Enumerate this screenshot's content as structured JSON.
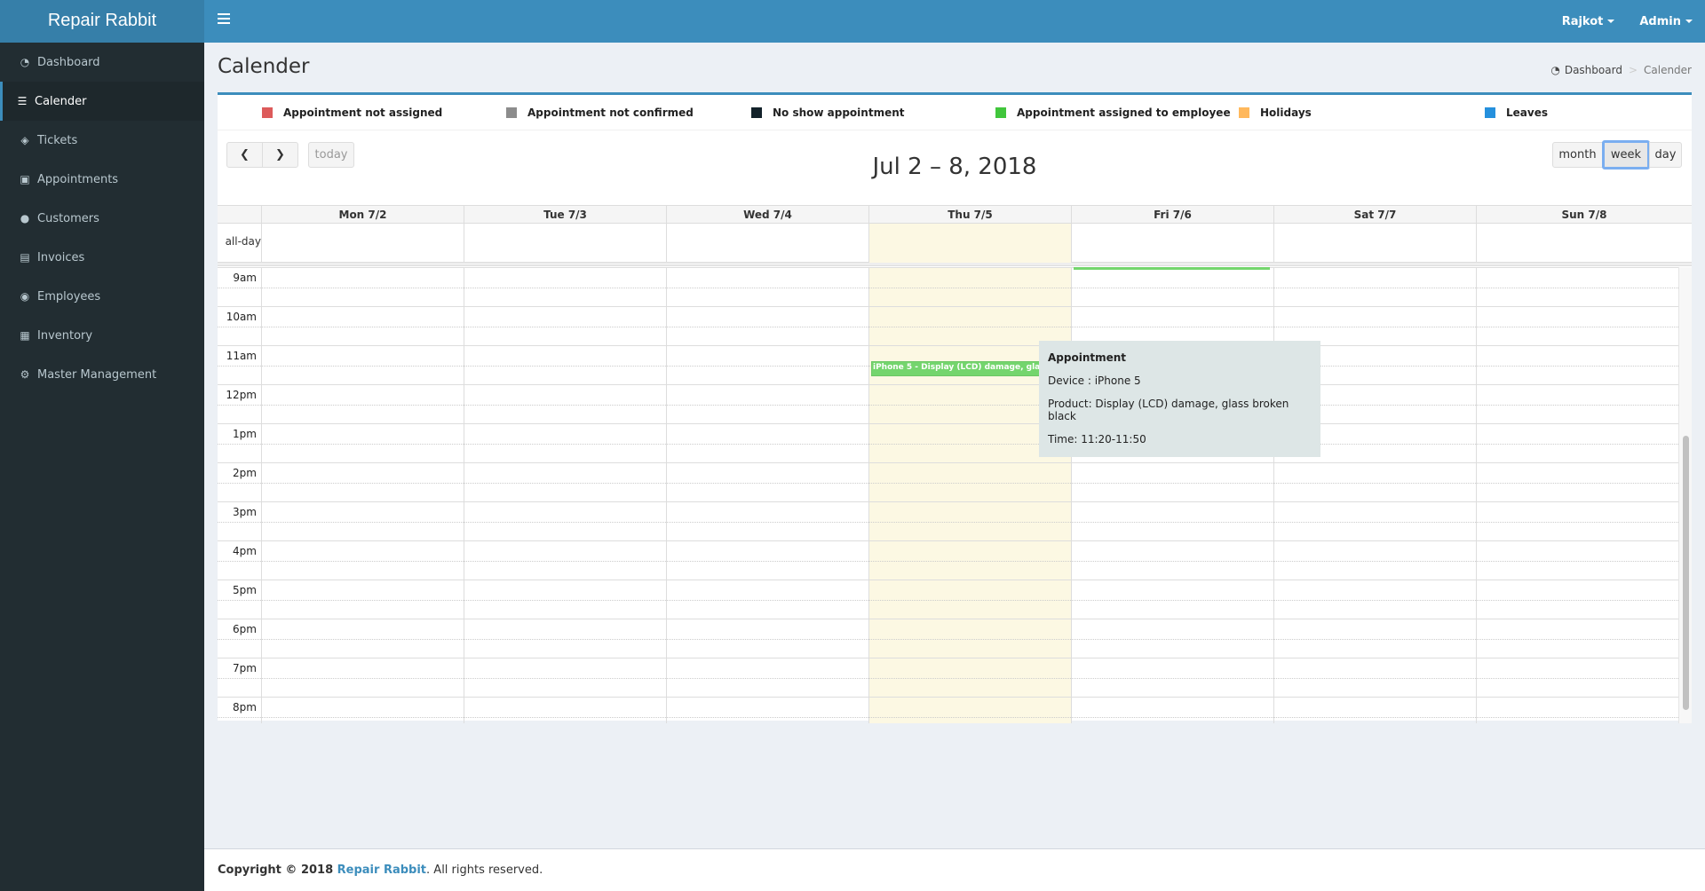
{
  "app": {
    "name": "Repair Rabbit"
  },
  "topnav": {
    "location": "Rajkot",
    "user": "Admin"
  },
  "sidebar": {
    "items": [
      {
        "label": "Dashboard",
        "icon": "dashboard-icon",
        "active": false
      },
      {
        "label": "Calender",
        "icon": "list-ol-icon",
        "active": true
      },
      {
        "label": "Tickets",
        "icon": "ticket-icon",
        "active": false
      },
      {
        "label": "Appointments",
        "icon": "calendar-plus-icon",
        "active": false
      },
      {
        "label": "Customers",
        "icon": "users-icon",
        "active": false
      },
      {
        "label": "Invoices",
        "icon": "file-text-icon",
        "active": false
      },
      {
        "label": "Employees",
        "icon": "user-circle-icon",
        "active": false
      },
      {
        "label": "Inventory",
        "icon": "list-alt-icon",
        "active": false
      },
      {
        "label": "Master Management",
        "icon": "cogs-icon",
        "active": false
      }
    ]
  },
  "page": {
    "title": "Calender",
    "breadcrumb": {
      "home": "Dashboard",
      "current": "Calender"
    }
  },
  "legend": [
    {
      "label": "Appointment not assigned",
      "color": "#dd5b5b"
    },
    {
      "label": "Appointment not confirmed",
      "color": "#8c8c8c"
    },
    {
      "label": "No show appointment",
      "color": "#13222a"
    },
    {
      "label": "Appointment assigned to employee",
      "color": "#41c63c"
    },
    {
      "label": "Holidays",
      "color": "#ffb85c"
    },
    {
      "label": "Leaves",
      "color": "#2590dd"
    }
  ],
  "calendar": {
    "title": "Jul 2 – 8, 2018",
    "today_label": "today",
    "views": {
      "month": "month",
      "week": "week",
      "day": "day",
      "active": "week"
    },
    "allday_label": "all-day",
    "days": [
      "Mon 7/2",
      "Tue 7/3",
      "Wed 7/4",
      "Thu 7/5",
      "Fri 7/6",
      "Sat 7/7",
      "Sun 7/8"
    ],
    "today_index": 3,
    "hours": [
      "9am",
      "10am",
      "11am",
      "12pm",
      "1pm",
      "2pm",
      "3pm",
      "4pm",
      "5pm",
      "6pm",
      "7pm",
      "8pm"
    ],
    "events": [
      {
        "title": "iPhone 5 - Display (LCD) damage, glass broken black",
        "day_index": 3,
        "start": "11:20",
        "end": "11:50",
        "color": "#74d56d"
      }
    ],
    "scroll_thumb": {
      "start_fraction": 0.37,
      "size_fraction": 0.6
    }
  },
  "tooltip": {
    "heading": "Appointment",
    "device": "Device : iPhone 5",
    "product": "Product: Display (LCD) damage, glass broken black",
    "time": "Time: 11:20-11:50"
  },
  "footer": {
    "prefix": "Copyright © 2018 ",
    "brand": "Repair Rabbit",
    "suffix": ". All rights reserved."
  }
}
